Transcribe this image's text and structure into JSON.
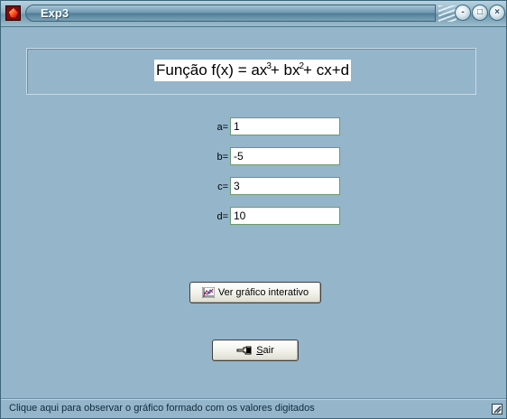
{
  "window": {
    "title": "Exp3",
    "buttons": {
      "minimize": "-",
      "maximize": "□",
      "close": "×"
    }
  },
  "header": {
    "formula_prefix": "Função f(x) = ax",
    "exp1": "3",
    "mid": "+ bx",
    "exp2": "2",
    "suffix": "+ cx+d"
  },
  "fields": [
    {
      "label": "a=",
      "value": "1"
    },
    {
      "label": "b=",
      "value": "-5"
    },
    {
      "label": "c=",
      "value": "3"
    },
    {
      "label": "d=",
      "value": "10"
    }
  ],
  "buttons": {
    "graph_label": "Ver gráfico interativo",
    "exit_label": "Sair"
  },
  "statusbar": {
    "text": "Clique aqui para observar o gráfico formado com os valores digitados"
  },
  "colors": {
    "background": "#94b5ca",
    "field_border": "#6c9a6e"
  }
}
